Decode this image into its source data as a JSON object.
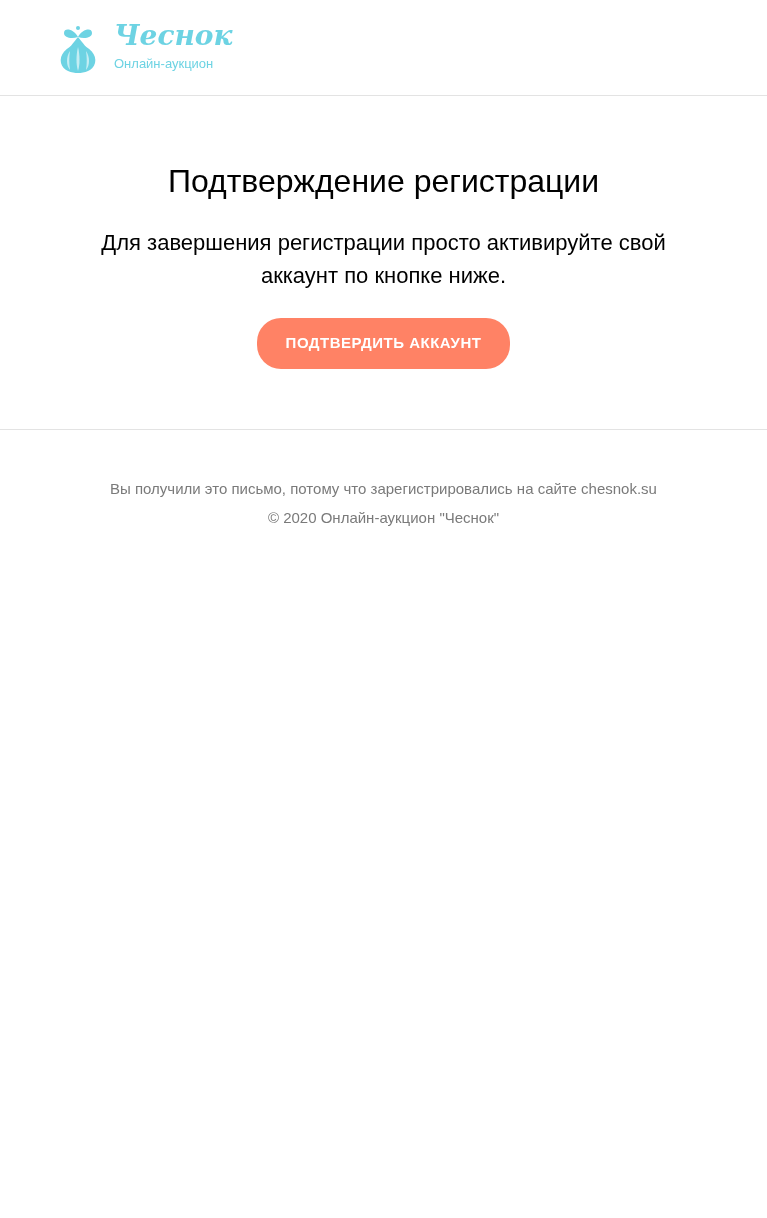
{
  "header": {
    "logo_title": "Чеснок",
    "logo_subtitle": "Онлайн-аукцион"
  },
  "main": {
    "title": "Подтверждение регистрации",
    "message_lines": [
      "Для завершения регистрации просто активируйте свой",
      "аккаунт по кнопке ниже."
    ],
    "button": "ПОДТВЕРДИТЬ АККАУНТ"
  },
  "footer": {
    "lines": [
      "Вы получили это письмо, потому что зарегистрировались на сайте chesnok.su",
      "© 2020 Онлайн-аукцион \"Чеснок\""
    ]
  }
}
